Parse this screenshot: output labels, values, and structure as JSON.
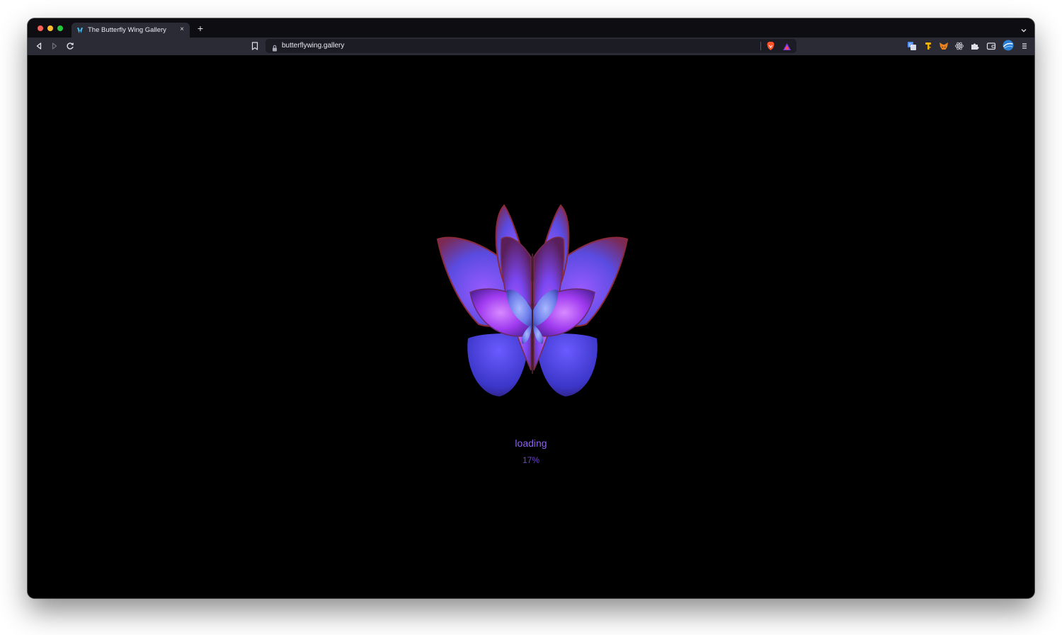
{
  "browser": {
    "tab": {
      "title": "The Butterfly Wing Gallery",
      "favicon": "butterfly-favicon-icon",
      "close_glyph": "×"
    },
    "new_tab_glyph": "+",
    "url": "butterflywing.gallery",
    "extensions": [
      "translate-icon",
      "key-icon",
      "metamask-fox-icon",
      "react-devtools-icon",
      "puzzle-extension-icon",
      "wallet-icon",
      "profile-avatar-icon",
      "menu-icon"
    ]
  },
  "page": {
    "loading_label": "loading",
    "progress_text": "17%",
    "progress_fraction": 0.17,
    "accent_color": "#8c62ee",
    "background_color": "#000000"
  }
}
